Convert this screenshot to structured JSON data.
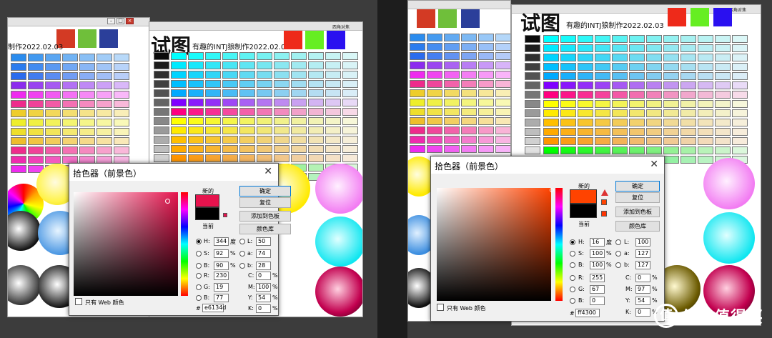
{
  "left": {
    "doc_title_big": "试图",
    "doc_title_small": "有趣的INTJ狼制作2022.02.03",
    "doc_title_partial": "制作2022.02.03",
    "corner_label": "西角对焦",
    "picker": {
      "title": "拾色器（前景色）",
      "buttons": [
        "确定",
        "复位",
        "添加到色板",
        "颜色库"
      ],
      "new_label": "新的",
      "current_label": "当前",
      "new_color": "#e6134d",
      "current_color": "#000000",
      "fields": {
        "H": "344",
        "S": "92",
        "B": "90",
        "R": "230",
        "G": "19",
        "B2": "77",
        "L": "50",
        "a": "74",
        "b": "28",
        "C": "0",
        "M": "100",
        "Y": "54",
        "K": "0"
      },
      "units": {
        "H": "度",
        "S": "%",
        "B": "%",
        "C": "%",
        "M": "%",
        "Y": "%",
        "K": "%"
      },
      "hex_label": "#",
      "hex": "e6134d",
      "web_only_label": "只有 Web 颜色"
    }
  },
  "right": {
    "doc_title_big": "试图",
    "doc_title_small": "有趣的INTJ狼制作2022.02.03",
    "corner_label": "西角对焦",
    "picker": {
      "title": "拾色器（前景色）",
      "buttons": [
        "确定",
        "复位",
        "添加到色板",
        "颜色库"
      ],
      "new_label": "新的",
      "current_label": "当前",
      "new_color": "#ff4300",
      "current_color": "#000000",
      "fields": {
        "H": "16",
        "S": "100",
        "B": "100",
        "R": "255",
        "G": "67",
        "B2": "0",
        "L": "100",
        "a": "127",
        "b": "127",
        "C": "0",
        "M": "97",
        "Y": "54",
        "K": "0"
      },
      "units": {
        "H": "度",
        "S": "%",
        "B": "%",
        "C": "%",
        "M": "%",
        "Y": "%",
        "K": "%"
      },
      "hex_label": "#",
      "hex": "ff4300",
      "web_only_label": "只有 Web 颜色"
    },
    "watermark": "什么值得买",
    "watermark_logo": "值"
  },
  "colors": {
    "swatch_red": "#d33a24",
    "swatch_green": "#6fbf3a",
    "swatch_blue": "#2b3f9a",
    "swatch_red2": "#ee2a1a",
    "swatch_green2": "#66ee22",
    "swatch_blue2": "#2a10f0"
  }
}
